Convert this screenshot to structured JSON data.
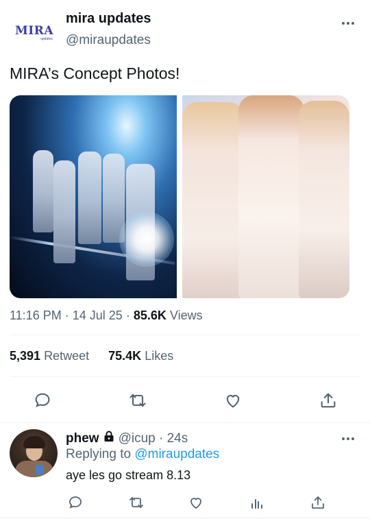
{
  "tweet": {
    "logo_text": "MIRA",
    "logo_subtext": "updates",
    "display_name": "mira updates",
    "handle": "@miraupdates",
    "text": "MIRA’s Concept Photos!",
    "time": "11:16 PM",
    "sep1": "·",
    "date": "14 Jul 25",
    "sep2": "·",
    "views_count": "85.6K",
    "views_label": "Views",
    "retweets_count": "5,391",
    "retweets_label": "Retweet",
    "likes_count": "75.4K",
    "likes_label": "Likes",
    "actions": [
      "reply-icon",
      "retweet-icon",
      "like-icon",
      "share-icon"
    ]
  },
  "reply": {
    "display_name": "phew",
    "handle_time": "@icup · 24s",
    "replying_prefix": "Replying to",
    "replying_to": "@miraupdates",
    "text": "aye les go stream 8.13",
    "actions": [
      "reply-icon",
      "retweet-icon",
      "like-icon",
      "analytics-icon",
      "share-icon"
    ]
  },
  "colors": {
    "text_primary": "#0f1419",
    "text_secondary": "#536471",
    "accent_link": "#1d9bf0",
    "logo": "#3b3ba8",
    "divider": "#eff3f4"
  }
}
